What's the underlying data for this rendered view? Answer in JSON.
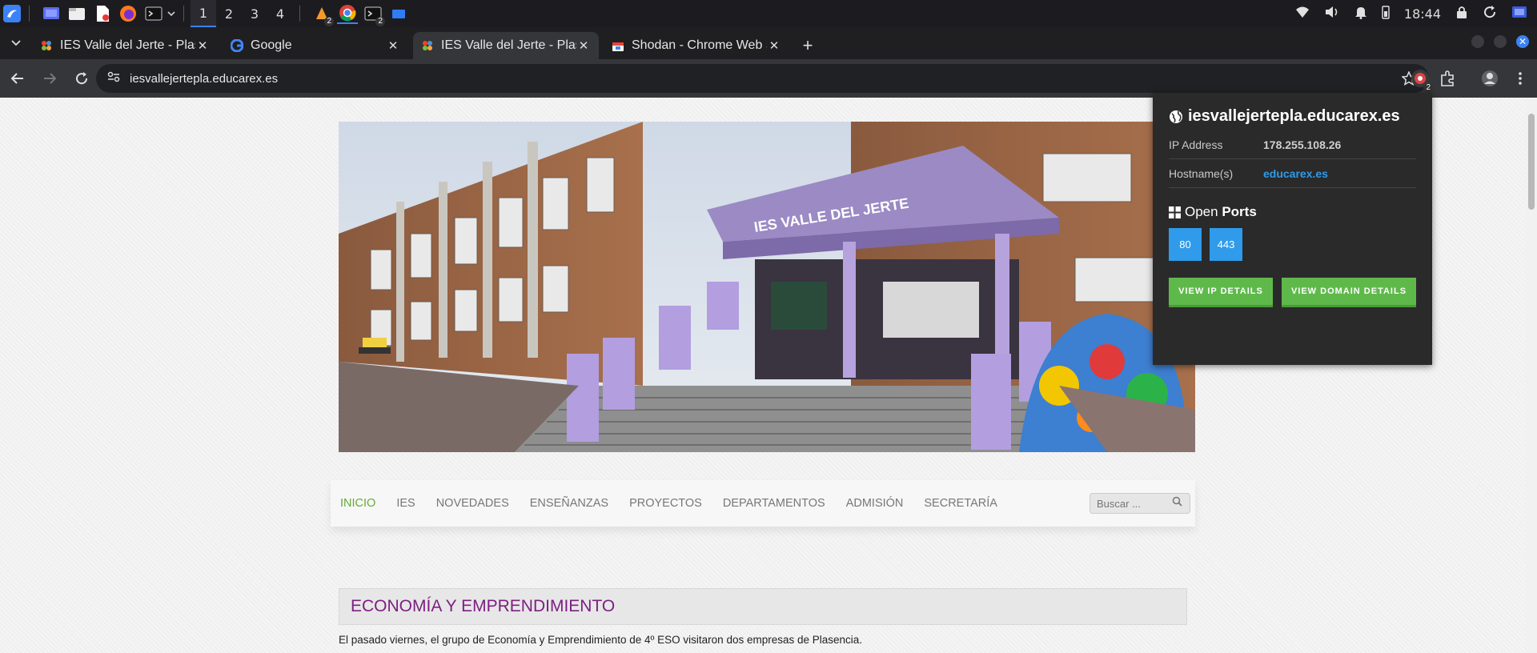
{
  "taskbar": {
    "workspaces": [
      "1",
      "2",
      "3",
      "4"
    ],
    "active_workspace": "1",
    "badges": {
      "app_a": "2",
      "app_b": "2"
    },
    "clock": "18:44",
    "icons": [
      "kde-menu-icon",
      "desktop-icon",
      "files-icon",
      "document-icon",
      "firefox-icon",
      "terminal-icon",
      "burp-icon",
      "chrome-icon",
      "terminal-2-icon",
      "folder-icon",
      "wifi-icon",
      "volume-icon",
      "bell-icon",
      "battery-icon",
      "lock-icon",
      "refresh-icon",
      "power-icon"
    ]
  },
  "browser": {
    "tabs": [
      {
        "title": "IES Valle del Jerte - Plasencia",
        "active": false,
        "favicon": "joomla-icon"
      },
      {
        "title": "Google",
        "active": false,
        "favicon": "google-icon"
      },
      {
        "title": "IES Valle del Jerte - Plasencia",
        "active": true,
        "favicon": "joomla-icon"
      },
      {
        "title": "Shodan - Chrome Web Store",
        "active": false,
        "favicon": "webstore-icon"
      }
    ],
    "new_tab": "+",
    "url": "iesvallejertepla.educarex.es",
    "extension_badge": "2"
  },
  "page": {
    "hero_sign": "IES VALLE DEL JERTE",
    "nav": [
      "INICIO",
      "IES",
      "NOVEDADES",
      "ENSEÑANZAS",
      "PROYECTOS",
      "DEPARTAMENTOS",
      "ADMISIÓN",
      "SECRETARÍA"
    ],
    "nav_active": "INICIO",
    "search_placeholder": "Buscar ...",
    "article_title": "ECONOMÍA Y EMPRENDIMIENTO",
    "article_text": "El pasado viernes, el grupo de Economía y Emprendimiento de 4º ESO visitaron dos empresas de Plasencia.",
    "accent_color": "#67a83a",
    "title_color": "#7c1f82"
  },
  "shodan_popup": {
    "host": "iesvallejertepla.educarex.es",
    "ip_label": "IP Address",
    "ip_value": "178.255.108.26",
    "hostnames_label": "Hostname(s)",
    "hostnames_value": "educarex.es",
    "ports_title_a": "Open",
    "ports_title_b": "Ports",
    "ports": [
      "80",
      "443"
    ],
    "btn_ip": "VIEW IP DETAILS",
    "btn_domain": "VIEW DOMAIN DETAILS",
    "port_color": "#2f9bea",
    "button_color": "#5fb94a"
  }
}
